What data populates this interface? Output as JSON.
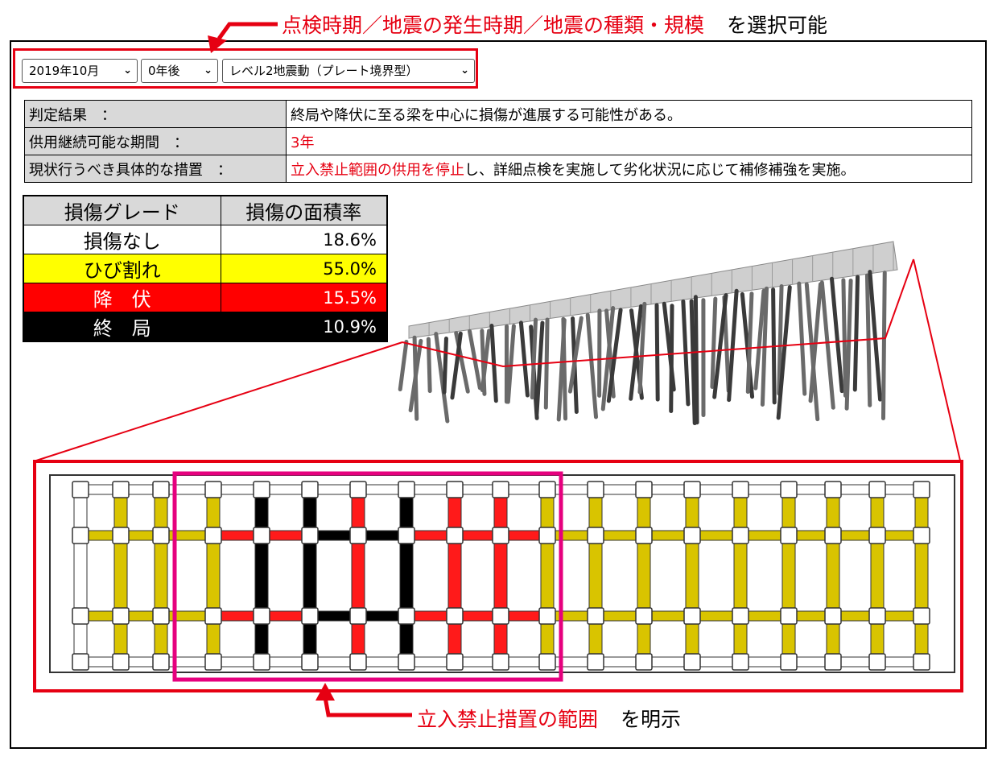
{
  "annotations": {
    "top_red": "点検時期／地震の発生時期／地震の種類・規模",
    "top_black": "を選択可能",
    "bottom_red": "立入禁止措置の範囲",
    "bottom_black": "を明示"
  },
  "selectors": {
    "inspection_period": "2019年10月",
    "years_after": "0年後",
    "earthquake_type": "レベル2地震動（プレート境界型）"
  },
  "assessment": {
    "result_label": "判定結果　：",
    "result_value": "終局や降伏に至る梁を中心に損傷が進展する可能性がある。",
    "service_label": "供用継続可能な期間　：",
    "service_value": "3年",
    "action_label": "現状行うべき具体的な措置　：",
    "action_value_red": "立入禁止範囲の供用を停止",
    "action_value_rest": "し、詳細点検を実施して劣化状況に応じて補修補強を実施。"
  },
  "damage_table": {
    "col_grade": "損傷グレード",
    "col_ratio": "損傷の面積率",
    "rows": [
      {
        "grade": "損傷なし",
        "ratio": "18.6%",
        "bg": "#ffffff",
        "fg": "#000000"
      },
      {
        "grade": "ひび割れ",
        "ratio": "55.0%",
        "bg": "#ffff00",
        "fg": "#000000"
      },
      {
        "grade": "降　伏",
        "ratio": "15.5%",
        "bg": "#ff0000",
        "fg": "#ffffff"
      },
      {
        "grade": "終　局",
        "ratio": "10.9%",
        "bg": "#000000",
        "fg": "#ffffff"
      }
    ]
  },
  "colors": {
    "accent_red": "#e60012",
    "no_damage": "#ffffff",
    "crack": "#d9c400",
    "yield": "#ff1a1a",
    "ultimate": "#000000",
    "restricted_zone": "#e6007e"
  }
}
